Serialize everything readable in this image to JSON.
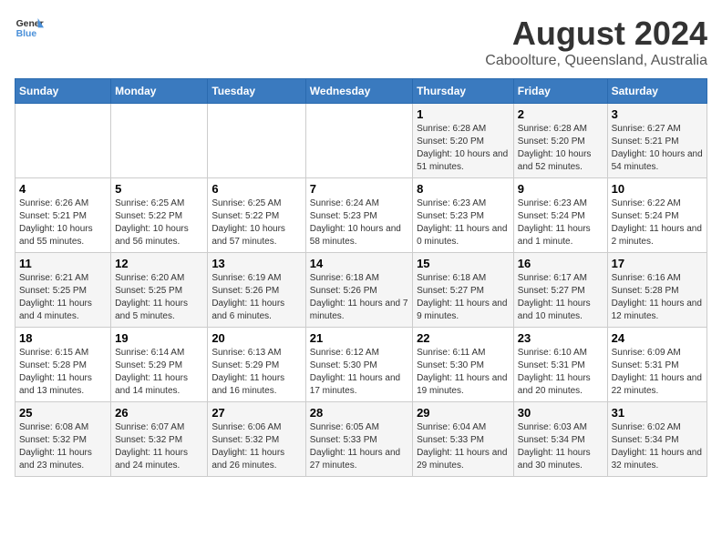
{
  "logo": {
    "line1": "General",
    "line2": "Blue"
  },
  "title": "August 2024",
  "subtitle": "Caboolture, Queensland, Australia",
  "days_of_week": [
    "Sunday",
    "Monday",
    "Tuesday",
    "Wednesday",
    "Thursday",
    "Friday",
    "Saturday"
  ],
  "weeks": [
    [
      {
        "day": "",
        "info": ""
      },
      {
        "day": "",
        "info": ""
      },
      {
        "day": "",
        "info": ""
      },
      {
        "day": "",
        "info": ""
      },
      {
        "day": "1",
        "info": "Sunrise: 6:28 AM\nSunset: 5:20 PM\nDaylight: 10 hours and 51 minutes."
      },
      {
        "day": "2",
        "info": "Sunrise: 6:28 AM\nSunset: 5:20 PM\nDaylight: 10 hours and 52 minutes."
      },
      {
        "day": "3",
        "info": "Sunrise: 6:27 AM\nSunset: 5:21 PM\nDaylight: 10 hours and 54 minutes."
      }
    ],
    [
      {
        "day": "4",
        "info": "Sunrise: 6:26 AM\nSunset: 5:21 PM\nDaylight: 10 hours and 55 minutes."
      },
      {
        "day": "5",
        "info": "Sunrise: 6:25 AM\nSunset: 5:22 PM\nDaylight: 10 hours and 56 minutes."
      },
      {
        "day": "6",
        "info": "Sunrise: 6:25 AM\nSunset: 5:22 PM\nDaylight: 10 hours and 57 minutes."
      },
      {
        "day": "7",
        "info": "Sunrise: 6:24 AM\nSunset: 5:23 PM\nDaylight: 10 hours and 58 minutes."
      },
      {
        "day": "8",
        "info": "Sunrise: 6:23 AM\nSunset: 5:23 PM\nDaylight: 11 hours and 0 minutes."
      },
      {
        "day": "9",
        "info": "Sunrise: 6:23 AM\nSunset: 5:24 PM\nDaylight: 11 hours and 1 minute."
      },
      {
        "day": "10",
        "info": "Sunrise: 6:22 AM\nSunset: 5:24 PM\nDaylight: 11 hours and 2 minutes."
      }
    ],
    [
      {
        "day": "11",
        "info": "Sunrise: 6:21 AM\nSunset: 5:25 PM\nDaylight: 11 hours and 4 minutes."
      },
      {
        "day": "12",
        "info": "Sunrise: 6:20 AM\nSunset: 5:25 PM\nDaylight: 11 hours and 5 minutes."
      },
      {
        "day": "13",
        "info": "Sunrise: 6:19 AM\nSunset: 5:26 PM\nDaylight: 11 hours and 6 minutes."
      },
      {
        "day": "14",
        "info": "Sunrise: 6:18 AM\nSunset: 5:26 PM\nDaylight: 11 hours and 7 minutes."
      },
      {
        "day": "15",
        "info": "Sunrise: 6:18 AM\nSunset: 5:27 PM\nDaylight: 11 hours and 9 minutes."
      },
      {
        "day": "16",
        "info": "Sunrise: 6:17 AM\nSunset: 5:27 PM\nDaylight: 11 hours and 10 minutes."
      },
      {
        "day": "17",
        "info": "Sunrise: 6:16 AM\nSunset: 5:28 PM\nDaylight: 11 hours and 12 minutes."
      }
    ],
    [
      {
        "day": "18",
        "info": "Sunrise: 6:15 AM\nSunset: 5:28 PM\nDaylight: 11 hours and 13 minutes."
      },
      {
        "day": "19",
        "info": "Sunrise: 6:14 AM\nSunset: 5:29 PM\nDaylight: 11 hours and 14 minutes."
      },
      {
        "day": "20",
        "info": "Sunrise: 6:13 AM\nSunset: 5:29 PM\nDaylight: 11 hours and 16 minutes."
      },
      {
        "day": "21",
        "info": "Sunrise: 6:12 AM\nSunset: 5:30 PM\nDaylight: 11 hours and 17 minutes."
      },
      {
        "day": "22",
        "info": "Sunrise: 6:11 AM\nSunset: 5:30 PM\nDaylight: 11 hours and 19 minutes."
      },
      {
        "day": "23",
        "info": "Sunrise: 6:10 AM\nSunset: 5:31 PM\nDaylight: 11 hours and 20 minutes."
      },
      {
        "day": "24",
        "info": "Sunrise: 6:09 AM\nSunset: 5:31 PM\nDaylight: 11 hours and 22 minutes."
      }
    ],
    [
      {
        "day": "25",
        "info": "Sunrise: 6:08 AM\nSunset: 5:32 PM\nDaylight: 11 hours and 23 minutes."
      },
      {
        "day": "26",
        "info": "Sunrise: 6:07 AM\nSunset: 5:32 PM\nDaylight: 11 hours and 24 minutes."
      },
      {
        "day": "27",
        "info": "Sunrise: 6:06 AM\nSunset: 5:32 PM\nDaylight: 11 hours and 26 minutes."
      },
      {
        "day": "28",
        "info": "Sunrise: 6:05 AM\nSunset: 5:33 PM\nDaylight: 11 hours and 27 minutes."
      },
      {
        "day": "29",
        "info": "Sunrise: 6:04 AM\nSunset: 5:33 PM\nDaylight: 11 hours and 29 minutes."
      },
      {
        "day": "30",
        "info": "Sunrise: 6:03 AM\nSunset: 5:34 PM\nDaylight: 11 hours and 30 minutes."
      },
      {
        "day": "31",
        "info": "Sunrise: 6:02 AM\nSunset: 5:34 PM\nDaylight: 11 hours and 32 minutes."
      }
    ]
  ]
}
